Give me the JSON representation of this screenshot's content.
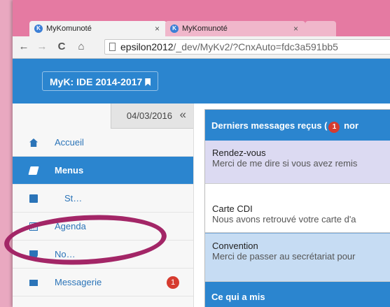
{
  "browser": {
    "tabs": [
      {
        "title": "MyKomunoté",
        "close": "×"
      },
      {
        "title": "MyKomunoté",
        "close": "×"
      }
    ],
    "favicon_letter": "K",
    "nav": {
      "back": "←",
      "forward": "→",
      "reload": "C",
      "home": "⌂"
    },
    "url_host": "epsilon2012",
    "url_path": "/_dev/MyKv2/?CnxAuto=fdc3a591bb5"
  },
  "app": {
    "brand": "MyK: IDE 2014-2017",
    "accent": "#2b85cf"
  },
  "sidebar": {
    "date": "04/03/2016",
    "collapse_symbol": "«",
    "items": [
      {
        "label": "Accueil",
        "icon": "home-icon"
      },
      {
        "label": "Menus",
        "icon": "book-icon",
        "active": true
      },
      {
        "label": "St…",
        "icon": "folder-icon"
      },
      {
        "label": "Agenda",
        "icon": "calendar-icon"
      },
      {
        "label": "No…",
        "icon": "trophy-icon"
      },
      {
        "label": "Messagerie",
        "icon": "envelope-icon",
        "badge": "1"
      }
    ]
  },
  "messages": {
    "header_prefix": "Derniers messages reçus (",
    "header_count": "1",
    "header_suffix": " nor",
    "items": [
      {
        "subject": "Rendez-vous",
        "body": "Merci de me dire si vous avez remis"
      },
      {
        "subject": "Carte CDI",
        "body": "Nous avons retrouvé votre carte d'a"
      },
      {
        "subject": "Convention",
        "body": "Merci de passer au secrétariat pour"
      }
    ],
    "footer": "Ce qui a mis"
  }
}
